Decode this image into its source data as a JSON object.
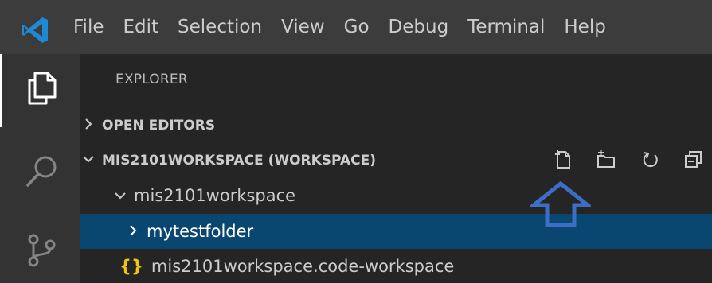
{
  "menubar": {
    "items": [
      "File",
      "Edit",
      "Selection",
      "View",
      "Go",
      "Debug",
      "Terminal",
      "Help"
    ]
  },
  "explorer": {
    "title": "EXPLORER",
    "open_editors_label": "OPEN EDITORS",
    "workspace_label": "MIS2101WORKSPACE (WORKSPACE)",
    "tree": {
      "root_folder": "mis2101workspace",
      "items": [
        {
          "label": "mytestfolder",
          "icon": "chevron-right-icon",
          "selected": true
        },
        {
          "label": "mis2101workspace.code-workspace",
          "icon": "json-braces-icon",
          "icon_text": "{}",
          "selected": false
        }
      ]
    }
  },
  "icons": {
    "logo": "vscode-logo",
    "activity": [
      "explorer-icon",
      "search-icon",
      "source-control-icon"
    ],
    "toolbar": [
      "new-file-icon",
      "new-folder-icon",
      "refresh-icon",
      "collapse-all-icon"
    ],
    "annotation": "up-arrow-annotation"
  },
  "colors": {
    "titlebar": "#3c3c3c",
    "activitybar": "#333333",
    "sidebar": "#252526",
    "selection": "#094771",
    "vscode_blue": "#007acc",
    "annotation_arrow": "#3c6ec6"
  }
}
